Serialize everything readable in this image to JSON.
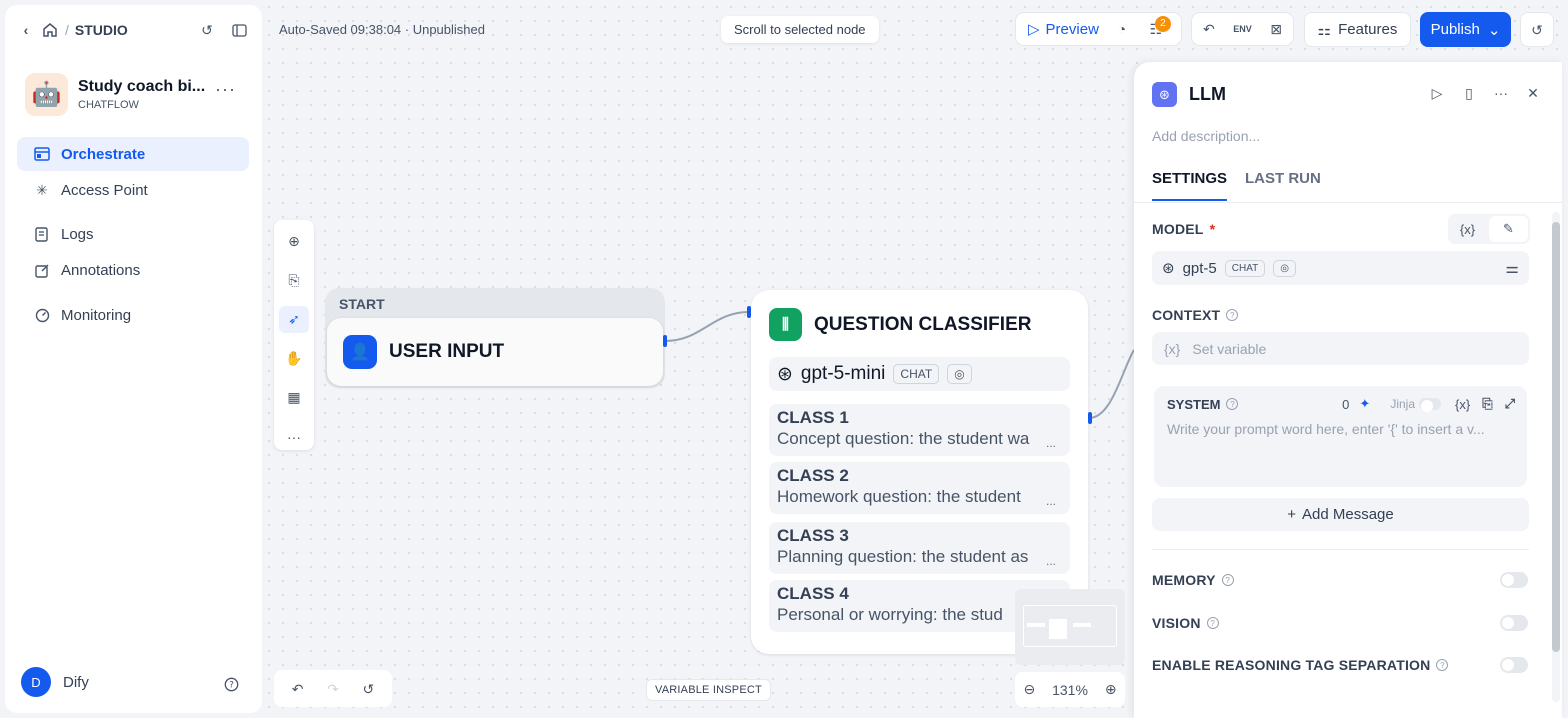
{
  "sidebar": {
    "breadcrumb": "STUDIO",
    "app": {
      "name": "Study coach bi...",
      "type": "CHATFLOW",
      "more": "···"
    },
    "nav": [
      {
        "label": "Orchestrate",
        "icon": "orchestrate-icon",
        "active": true
      },
      {
        "label": "Access Point",
        "icon": "access-point-icon"
      },
      {
        "label": "Logs",
        "icon": "logs-icon"
      },
      {
        "label": "Annotations",
        "icon": "annotations-icon"
      },
      {
        "label": "Monitoring",
        "icon": "monitoring-icon"
      }
    ],
    "user": {
      "initial": "D",
      "name": "Dify"
    }
  },
  "header": {
    "autosave": "Auto-Saved 09:38:04 · Unpublished",
    "scroll_button": "Scroll to selected node",
    "preview": "Preview",
    "checklist_badge": "2",
    "features": "Features",
    "publish": "Publish"
  },
  "nodes": {
    "start": {
      "label": "START",
      "title": "USER INPUT"
    },
    "classifier": {
      "title": "QUESTION CLASSIFIER",
      "model": "gpt-5-mini",
      "model_tag": "CHAT",
      "classes": [
        {
          "title": "CLASS 1",
          "desc": "Concept question: the student wa"
        },
        {
          "title": "CLASS 2",
          "desc": "Homework question: the student "
        },
        {
          "title": "CLASS 3",
          "desc": "Planning question: the student as"
        },
        {
          "title": "CLASS 4",
          "desc": "Personal or worrying: the stud"
        }
      ],
      "ellipsis": "..."
    }
  },
  "canvas": {
    "variable_inspect": "VARIABLE INSPECT",
    "zoom": "131%"
  },
  "panel": {
    "title": "LLM",
    "description_placeholder": "Add description...",
    "tabs": [
      "SETTINGS",
      "LAST RUN"
    ],
    "model_label": "MODEL",
    "required": "*",
    "var_symbol": "{x}",
    "model": {
      "name": "gpt-5",
      "tag": "CHAT"
    },
    "context_label": "CONTEXT",
    "context_placeholder": "Set variable",
    "system": {
      "label": "SYSTEM",
      "count": "0",
      "jinja": "Jinja",
      "placeholder": "Write your prompt word here, enter '{' to insert a v..."
    },
    "add_message": "Add Message",
    "memory": "MEMORY",
    "vision": "VISION",
    "reasoning": "ENABLE REASONING TAG SEPARATION"
  },
  "colors": {
    "accent": "#155aef",
    "classifier": "#11a161",
    "llm": "#6172f3",
    "badge": "#f79009"
  }
}
